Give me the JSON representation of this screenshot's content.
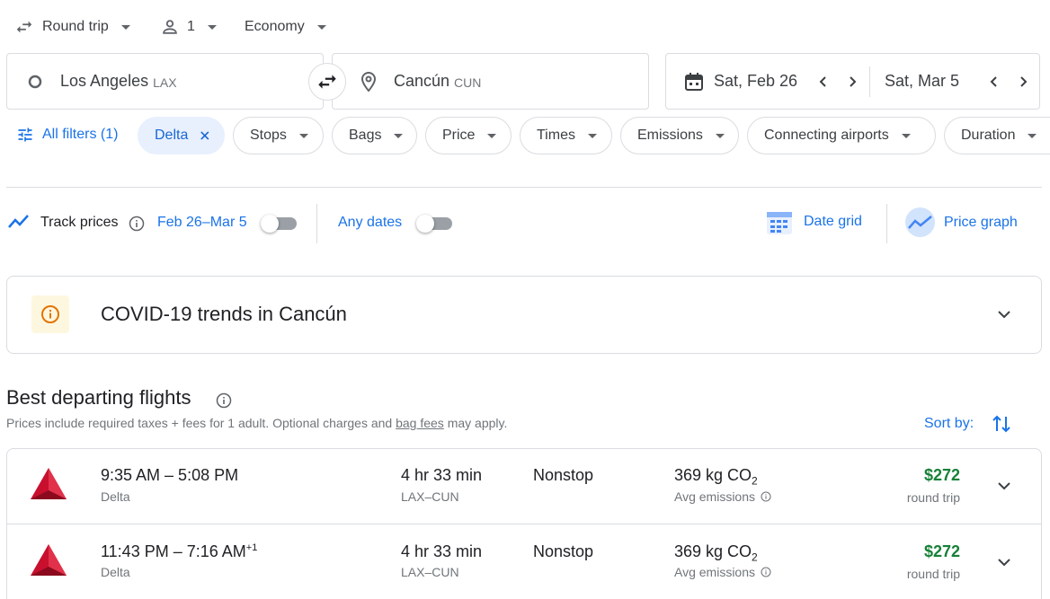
{
  "top_bar": {
    "trip_type": "Round trip",
    "passengers": "1",
    "cabin": "Economy"
  },
  "search": {
    "origin_city": "Los Angeles",
    "origin_code": "LAX",
    "destination_city": "Cancún",
    "destination_code": "CUN",
    "depart_date": "Sat, Feb 26",
    "return_date": "Sat, Mar 5"
  },
  "filters": {
    "all_filters": "All filters (1)",
    "active_chip": "Delta",
    "chips": [
      "Stops",
      "Bags",
      "Price",
      "Times",
      "Emissions",
      "Connecting airports",
      "Duration"
    ]
  },
  "tracking": {
    "track_prices": "Track prices",
    "date_range": "Feb 26–Mar 5",
    "any_dates": "Any dates",
    "date_grid": "Date grid",
    "price_graph": "Price graph"
  },
  "covid": {
    "title": "COVID-19 trends in Cancún"
  },
  "results": {
    "heading": "Best departing flights",
    "note_prefix": "Prices include required taxes + fees for 1 adult. Optional charges and ",
    "note_link": "bag fees",
    "note_suffix": " may apply.",
    "sort_label": "Sort by:"
  },
  "flights": [
    {
      "times": "9:35 AM – 5:08 PM",
      "day_offset": "",
      "airline": "Delta",
      "duration": "4 hr 33 min",
      "route": "LAX–CUN",
      "stops": "Nonstop",
      "emissions_value": "369 kg CO",
      "emissions_sub": "2",
      "emissions_label": "Avg emissions",
      "price": "$272",
      "price_note": "round trip"
    },
    {
      "times": "11:43 PM – 7:16 AM",
      "day_offset": "+1",
      "airline": "Delta",
      "duration": "4 hr 33 min",
      "route": "LAX–CUN",
      "stops": "Nonstop",
      "emissions_value": "369 kg CO",
      "emissions_sub": "2",
      "emissions_label": "Avg emissions",
      "price": "$272",
      "price_note": "round trip"
    }
  ],
  "colors": {
    "accent": "#1a73e8",
    "price_green": "#188038",
    "delta_red": "#c8102e",
    "chip_active_bg": "#e8f0fe"
  }
}
